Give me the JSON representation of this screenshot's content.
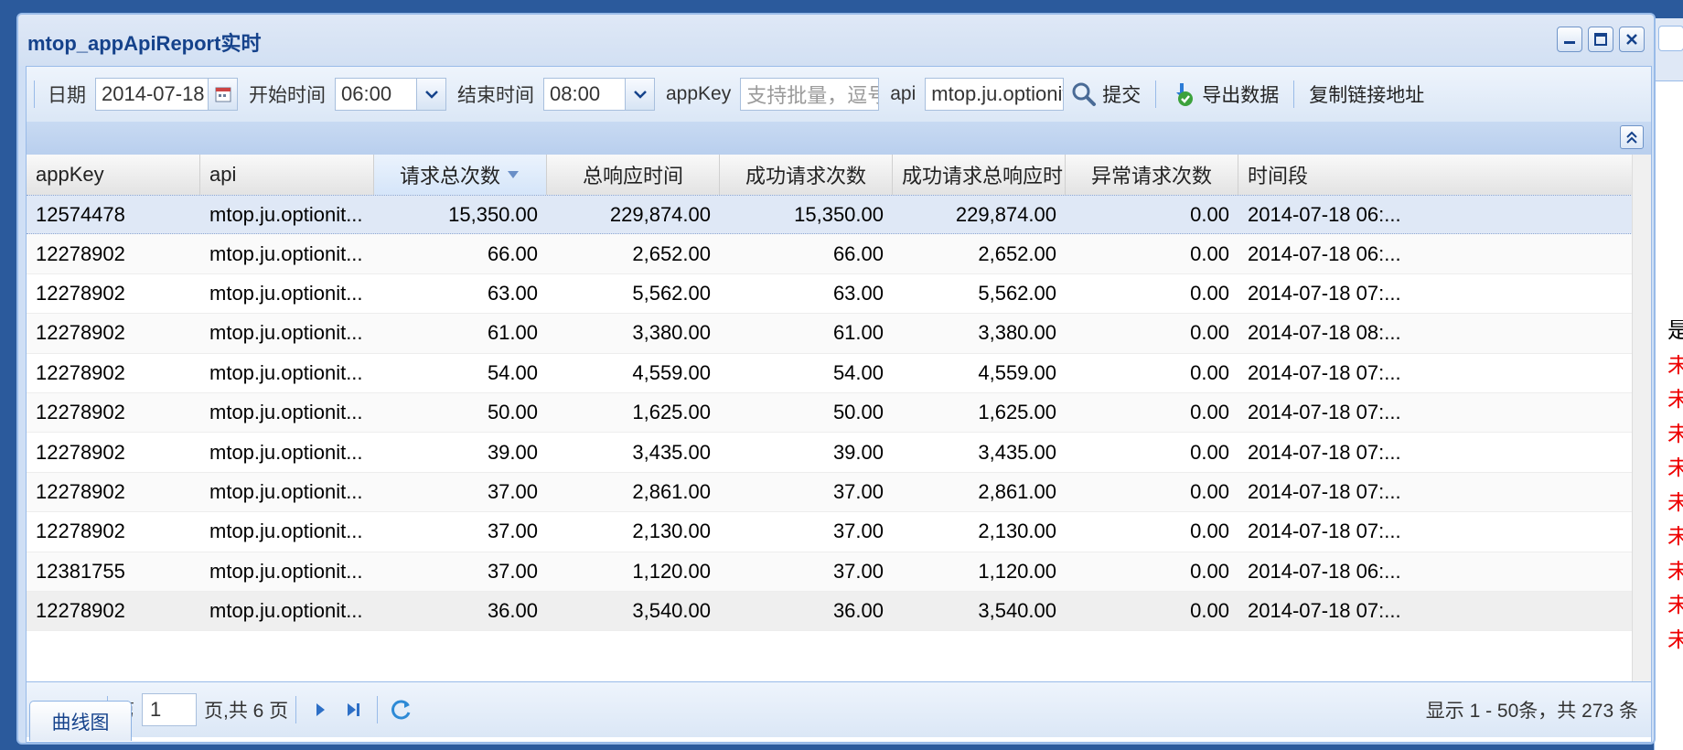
{
  "window": {
    "title": "mtop_appApiReport实时"
  },
  "toolbar": {
    "date_label": "日期",
    "date_value": "2014-07-18",
    "start_label": "开始时间",
    "start_value": "06:00",
    "end_label": "结束时间",
    "end_value": "08:00",
    "appkey_label": "appKey",
    "appkey_placeholder": "支持批量，逗号",
    "api_label": "api",
    "api_value": "mtop.ju.optionit",
    "submit_label": "提交",
    "export_label": "导出数据",
    "copy_link_label": "复制链接地址"
  },
  "grid": {
    "columns": [
      "appKey",
      "api",
      "请求总次数",
      "总响应时间",
      "成功请求次数",
      "成功请求总响应时间",
      "异常请求次数",
      "时间段"
    ],
    "sorted_column": "请求总次数",
    "rows": [
      [
        "12574478",
        "mtop.ju.optionit...",
        "15,350.00",
        "229,874.00",
        "15,350.00",
        "229,874.00",
        "0.00",
        "2014-07-18 06:..."
      ],
      [
        "12278902",
        "mtop.ju.optionit...",
        "66.00",
        "2,652.00",
        "66.00",
        "2,652.00",
        "0.00",
        "2014-07-18 06:..."
      ],
      [
        "12278902",
        "mtop.ju.optionit...",
        "63.00",
        "5,562.00",
        "63.00",
        "5,562.00",
        "0.00",
        "2014-07-18 07:..."
      ],
      [
        "12278902",
        "mtop.ju.optionit...",
        "61.00",
        "3,380.00",
        "61.00",
        "3,380.00",
        "0.00",
        "2014-07-18 08:..."
      ],
      [
        "12278902",
        "mtop.ju.optionit...",
        "54.00",
        "4,559.00",
        "54.00",
        "4,559.00",
        "0.00",
        "2014-07-18 07:..."
      ],
      [
        "12278902",
        "mtop.ju.optionit...",
        "50.00",
        "1,625.00",
        "50.00",
        "1,625.00",
        "0.00",
        "2014-07-18 07:..."
      ],
      [
        "12278902",
        "mtop.ju.optionit...",
        "39.00",
        "3,435.00",
        "39.00",
        "3,435.00",
        "0.00",
        "2014-07-18 07:..."
      ],
      [
        "12278902",
        "mtop.ju.optionit...",
        "37.00",
        "2,861.00",
        "37.00",
        "2,861.00",
        "0.00",
        "2014-07-18 07:..."
      ],
      [
        "12278902",
        "mtop.ju.optionit...",
        "37.00",
        "2,130.00",
        "37.00",
        "2,130.00",
        "0.00",
        "2014-07-18 07:..."
      ],
      [
        "12381755",
        "mtop.ju.optionit...",
        "37.00",
        "1,120.00",
        "37.00",
        "1,120.00",
        "0.00",
        "2014-07-18 06:..."
      ],
      [
        "12278902",
        "mtop.ju.optionit...",
        "36.00",
        "3,540.00",
        "36.00",
        "3,540.00",
        "0.00",
        "2014-07-18 07:..."
      ]
    ]
  },
  "pager": {
    "page_prefix": "第",
    "page_value": "1",
    "page_suffix": "页,共 6 页",
    "info": "显示 1 - 50条，共 273 条"
  },
  "tabs": {
    "chart_tab": "曲线图"
  },
  "background_window": {
    "chars": [
      "是",
      "未",
      "未",
      "未",
      "未",
      "未",
      "未",
      "未",
      "未",
      "未"
    ]
  },
  "colors": {
    "header_blue": "#15428b",
    "border_blue": "#99bbe8",
    "red_text": "#ee0000"
  }
}
